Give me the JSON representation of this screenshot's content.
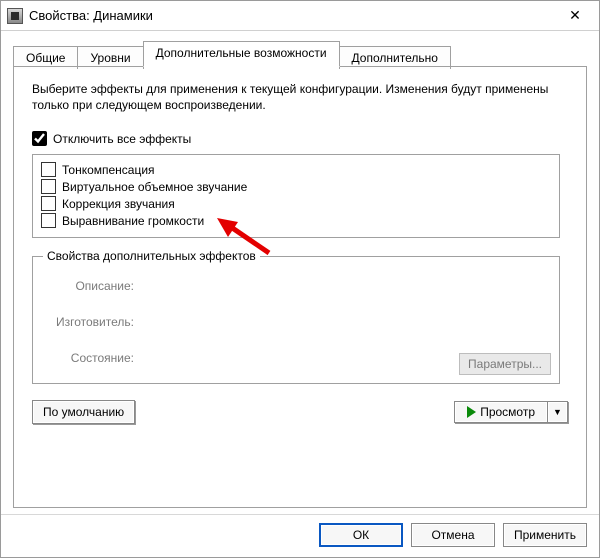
{
  "window": {
    "title": "Свойства: Динамики"
  },
  "tabs": {
    "general": "Общие",
    "levels": "Уровни",
    "enhancements": "Дополнительные возможности",
    "advanced": "Дополнительно"
  },
  "panel": {
    "instruction": "Выберите эффекты для применения к текущей конфигурации. Изменения будут применены только при следующем воспроизведении.",
    "disable_all_label": "Отключить все эффекты",
    "disable_all_checked": true,
    "effects": [
      {
        "label": "Тонкомпенсация",
        "checked": false
      },
      {
        "label": "Виртуальное объемное звучание",
        "checked": false
      },
      {
        "label": "Коррекция звучания",
        "checked": false
      },
      {
        "label": "Выравнивание громкости",
        "checked": false
      }
    ],
    "group_title": "Свойства дополнительных эффектов",
    "desc_label": "Описание:",
    "vendor_label": "Изготовитель:",
    "status_label": "Состояние:",
    "params_button": "Параметры...",
    "defaults_button": "По умолчанию",
    "preview_button": "Просмотр"
  },
  "dialog_buttons": {
    "ok": "ОК",
    "cancel": "Отмена",
    "apply": "Применить"
  }
}
